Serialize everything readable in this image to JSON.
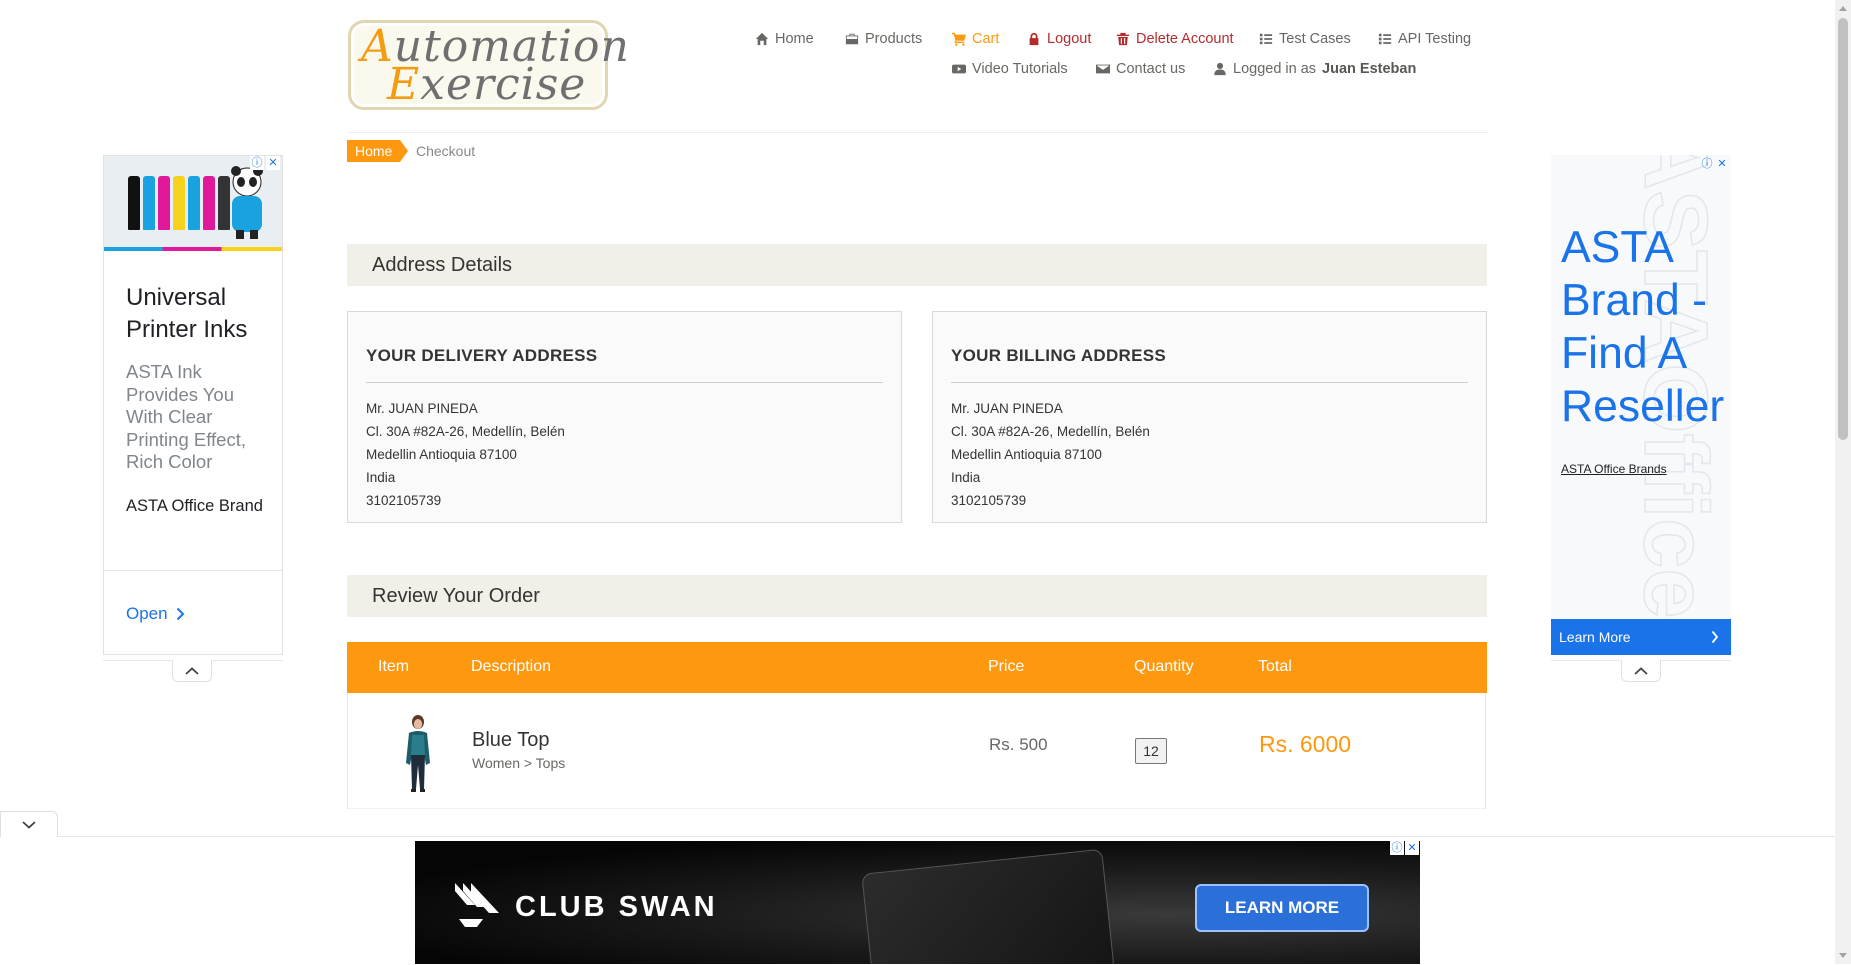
{
  "logo": {
    "line1": "Automation",
    "line2": "Exercise"
  },
  "nav": {
    "home": "Home",
    "products": "Products",
    "cart": "Cart",
    "logout": "Logout",
    "delete_account": "Delete Account",
    "test_cases": "Test Cases",
    "api_testing": "API Testing",
    "video_tutorials": "Video Tutorials",
    "contact_us": "Contact us",
    "logged_in_prefix": "Logged in as",
    "logged_in_user": "Juan Esteban"
  },
  "breadcrumb": {
    "home": "Home",
    "current": "Checkout"
  },
  "address_section": {
    "title": "Address Details",
    "delivery": {
      "heading": "YOUR DELIVERY ADDRESS",
      "name": "Mr. JUAN PINEDA",
      "address1": "Cl. 30A #82A-26, Medellín, Belén",
      "city_state_zip": "Medellin Antioquia 87100",
      "country": "India",
      "phone": "3102105739"
    },
    "billing": {
      "heading": "YOUR BILLING ADDRESS",
      "name": "Mr. JUAN PINEDA",
      "address1": "Cl. 30A #82A-26, Medellín, Belén",
      "city_state_zip": "Medellin Antioquia 87100",
      "country": "India",
      "phone": "3102105739"
    }
  },
  "review_section": {
    "title": "Review Your Order",
    "columns": {
      "item": "Item",
      "description": "Description",
      "price": "Price",
      "quantity": "Quantity",
      "total": "Total"
    },
    "rows": [
      {
        "name": "Blue Top",
        "category": "Women > Tops",
        "price": "Rs. 500",
        "quantity": "12",
        "total": "Rs. 6000"
      }
    ]
  },
  "ads": {
    "left": {
      "title": "Universal Printer Inks",
      "description": "ASTA Ink Provides You With Clear Printing Effect, Rich Color",
      "brand": "ASTA Office Brand",
      "cta": "Open"
    },
    "right": {
      "headline": "ASTA Brand - Find A Reseller",
      "advertiser": "ASTA Office Brands",
      "cta": "Learn More"
    },
    "bottom": {
      "brand": "CLUB SWAN",
      "cta": "LEARN MORE"
    }
  },
  "colors": {
    "accent": "#fe980f",
    "danger": "#b32d2d",
    "section_bg": "#f0f0e9",
    "ad_blue": "#1a73e8"
  }
}
